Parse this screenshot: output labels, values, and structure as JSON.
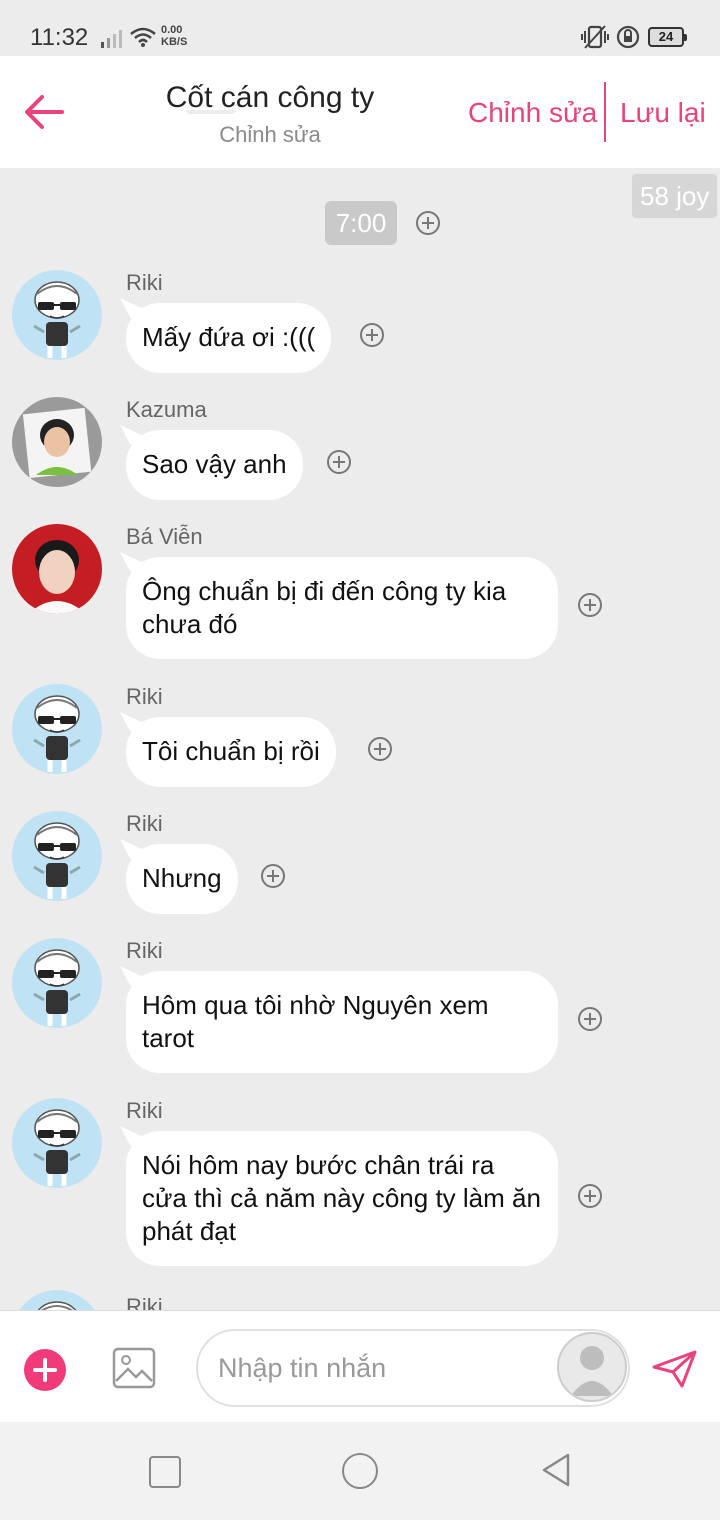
{
  "status_bar": {
    "time": "11:32",
    "speed_value": "0.00",
    "speed_unit": "KB/S",
    "battery": "24"
  },
  "header": {
    "title": "Cốt cán công ty",
    "subtitle": "Chỉnh sửa",
    "edit_label": "Chỉnh sửa",
    "save_label": "Lưu lại"
  },
  "badge": "58 joy",
  "time_marker": "7:00",
  "messages": [
    {
      "sender": "Riki",
      "text": "Mấy đứa ơi :(((",
      "avatar": "riki-avatar"
    },
    {
      "sender": "Kazuma",
      "text": "Sao vậy anh",
      "avatar": "kazuma-avatar"
    },
    {
      "sender": "Bá Viễn",
      "text": "Ông chuẩn bị đi đến công ty kia chưa đó",
      "avatar": "ba-vien-avatar"
    },
    {
      "sender": "Riki",
      "text": "Tôi chuẩn bị rồi",
      "avatar": "riki-avatar"
    },
    {
      "sender": "Riki",
      "text": "Nhưng",
      "avatar": "riki-avatar"
    },
    {
      "sender": "Riki",
      "text": "Hôm qua tôi nhờ Nguyên xem tarot",
      "avatar": "riki-avatar"
    },
    {
      "sender": "Riki",
      "text": "Nói hôm nay bước chân trái ra cửa thì cả năm này công ty làm ăn phát đạt",
      "avatar": "riki-avatar"
    },
    {
      "sender": "Riki",
      "text": "",
      "avatar": "riki-avatar"
    }
  ],
  "composer": {
    "placeholder": "Nhập tin nhắn"
  },
  "colors": {
    "accent": "#e9437a",
    "background": "#ececec",
    "bubble": "#ffffff"
  }
}
